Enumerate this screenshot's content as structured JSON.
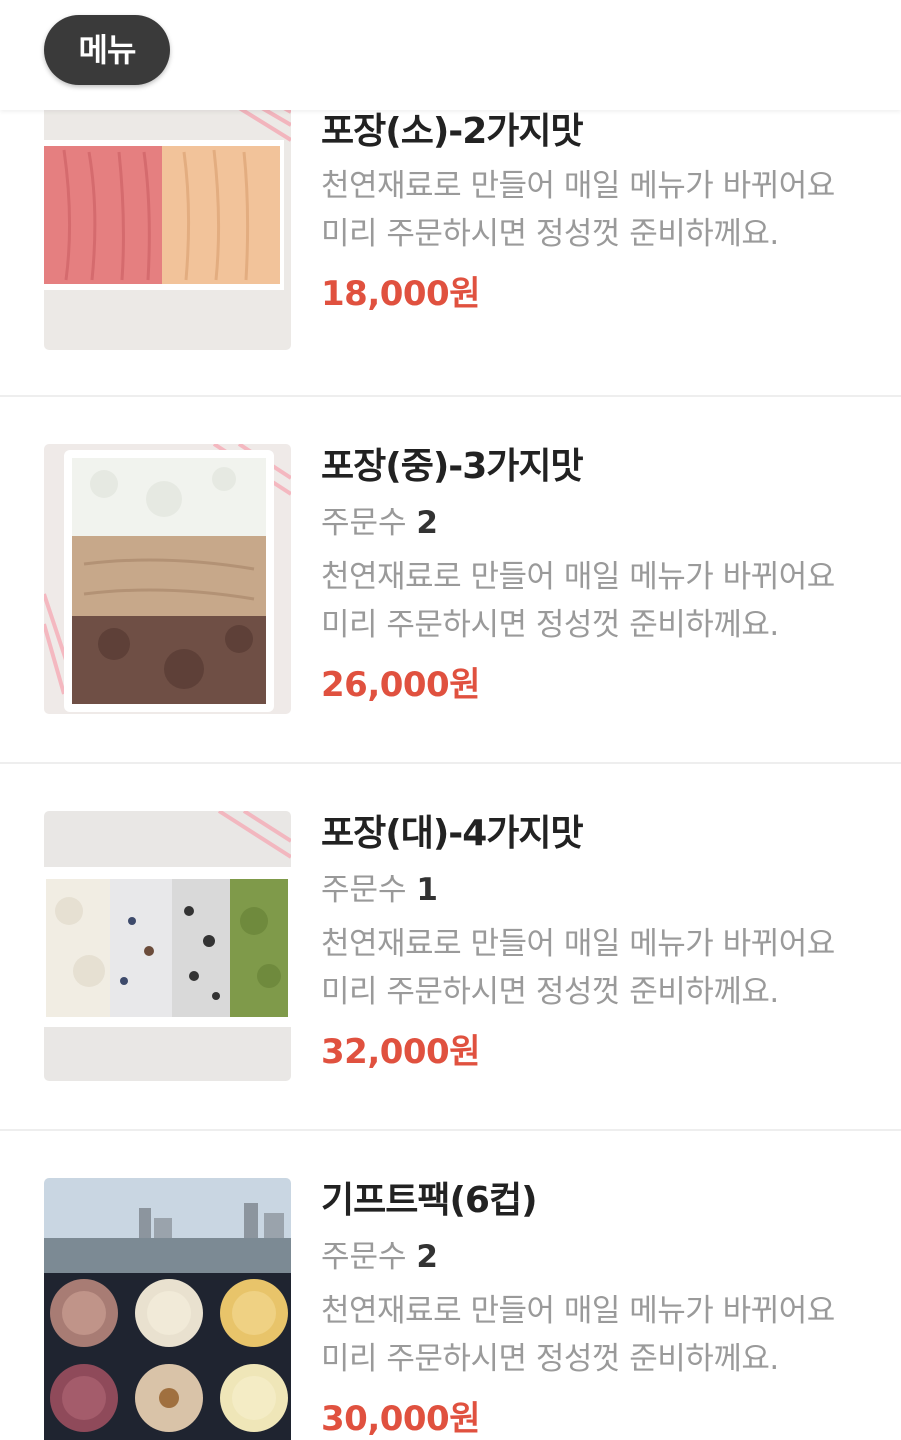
{
  "header": {
    "menu_label": "메뉴"
  },
  "items": [
    {
      "name": "포장(소)-2가지맛",
      "desc_line1": "천연재료로 만들어 매일 메뉴가 바뀌어요",
      "desc_line2": "미리 주문하시면 정성껏 준비하께요.",
      "price": "18,000원"
    },
    {
      "name": "포장(중)-3가지맛",
      "orders_label": "주문수",
      "orders_count": "2",
      "desc_line1": "천연재료로 만들어 매일 메뉴가 바뀌어요",
      "desc_line2": "미리 주문하시면 정성껏 준비하께요.",
      "price": "26,000원"
    },
    {
      "name": "포장(대)-4가지맛",
      "orders_label": "주문수",
      "orders_count": "1",
      "desc_line1": "천연재료로 만들어 매일 메뉴가 바뀌어요",
      "desc_line2": "미리 주문하시면 정성껏 준비하께요.",
      "price": "32,000원"
    },
    {
      "name": "기프트팩(6컵)",
      "orders_label": "주문수",
      "orders_count": "2",
      "desc_line1": "천연재료로 만들어 매일 메뉴가 바뀌어요",
      "desc_line2": "미리 주문하시면 정성껏 준비하께요.",
      "price": "30,000원"
    }
  ],
  "colors": {
    "price": "#e0513f",
    "menu_pill": "#3a3a3a"
  }
}
